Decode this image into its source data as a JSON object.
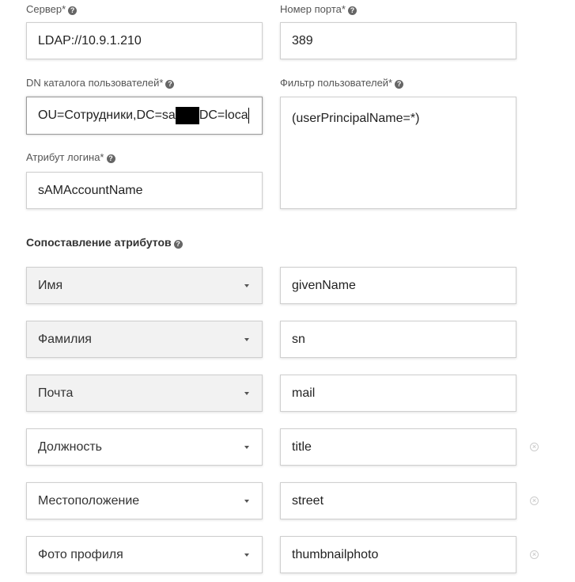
{
  "server": {
    "label": "Сервер*",
    "value": "LDAP://10.9.1.210"
  },
  "port": {
    "label": "Номер порта*",
    "value": "389"
  },
  "user_dn": {
    "label": "DN каталога пользователей*",
    "value_prefix": "OU=Сотрудники,DC=sa",
    "value_suffix": "DC=loca"
  },
  "user_filter": {
    "label": "Фильтр пользователей*",
    "value": "(userPrincipalName=*)"
  },
  "login_attr": {
    "label": "Атрибут логина*",
    "value": "sAMAccountName"
  },
  "mapping": {
    "title": "Сопоставление атрибутов",
    "rows": [
      {
        "field": "Имя",
        "attribute": "givenName"
      },
      {
        "field": "Фамилия",
        "attribute": "sn"
      },
      {
        "field": "Почта",
        "attribute": "mail"
      },
      {
        "field": "Должность",
        "attribute": "title"
      },
      {
        "field": "Местоположение",
        "attribute": "street"
      },
      {
        "field": "Фото профиля",
        "attribute": "thumbnailphoto"
      }
    ]
  },
  "icons": {
    "help": "question-circle-icon",
    "dropdown": "caret-down-icon",
    "remove": "remove-circle-icon"
  },
  "colors": {
    "input_border": "#cfcfcf",
    "locked_select_bg": "#f2f2f2",
    "label_text": "#555555"
  }
}
